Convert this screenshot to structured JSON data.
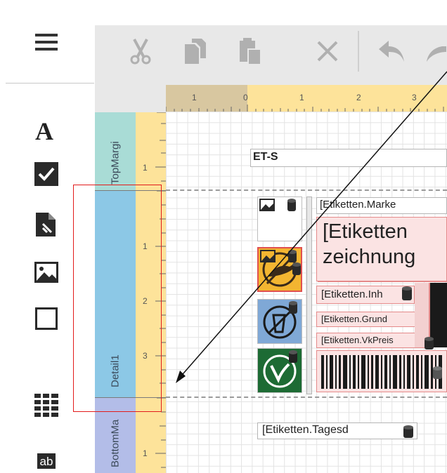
{
  "toolbox": {
    "items": [
      {
        "name": "text",
        "icon": "text-icon"
      },
      {
        "name": "checkbox",
        "icon": "checkbox-icon"
      },
      {
        "name": "rich-text",
        "icon": "richtext-icon"
      },
      {
        "name": "picture",
        "icon": "picture-icon"
      },
      {
        "name": "shape",
        "icon": "shape-icon"
      },
      {
        "name": "table",
        "icon": "table-icon"
      },
      {
        "name": "label",
        "icon": "label-icon",
        "text": "ab"
      }
    ]
  },
  "toolbar": {
    "buttons": [
      "cut",
      "copy",
      "paste",
      "delete",
      "undo",
      "redo"
    ]
  },
  "ruler": {
    "h_labels_left": [
      "1"
    ],
    "h_labels_right": [
      "0",
      "1",
      "2",
      "3"
    ]
  },
  "bands": {
    "top": {
      "label": "TopMargi",
      "ruler_numbers": [
        "1"
      ]
    },
    "detail": {
      "label": "Detail1",
      "ruler_numbers": [
        "1",
        "2",
        "3"
      ]
    },
    "bottom": {
      "label": "BottomMa",
      "ruler_numbers": [
        "1"
      ]
    }
  },
  "controls": {
    "et_label": "ET-S",
    "marke": "[Etiketten.Marke",
    "bezeichnung_line1": "[Etiketten",
    "bezeichnung_line2": "zeichnung",
    "inhalt": "[Etiketten.Inh",
    "grundpreis": "[Etiketten.Grund",
    "vkpreis": "[Etiketten.VkPreis",
    "tagesdatum": "[Etiketten.Tagesd"
  },
  "colors": {
    "toolbar_bg": "#e8e8e8",
    "ruler_yellow": "#fde39a",
    "top_band": "#a9dcd6",
    "detail_band": "#8cc8e6",
    "bottom_band": "#b3bde8",
    "selection_red": "#e21b1b",
    "field_pink": "#fbe3e3"
  }
}
